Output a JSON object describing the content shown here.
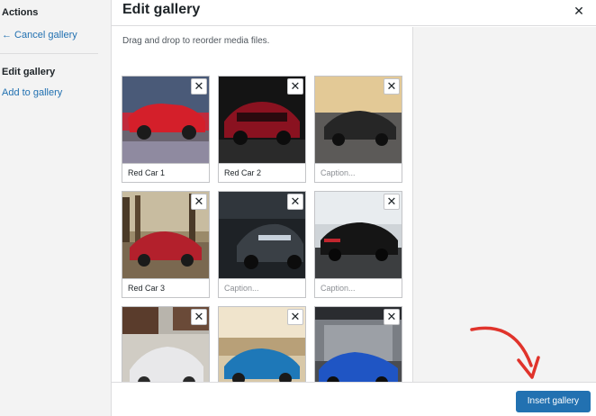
{
  "sidebar": {
    "heading": "Actions",
    "cancel_link": "← Cancel gallery",
    "active_item": "Edit gallery",
    "add_link": "Add to gallery"
  },
  "header": {
    "title": "Edit gallery",
    "close_icon": "close-icon",
    "close_glyph": "✕"
  },
  "instructions": "Drag and drop to reorder media files.",
  "gallery": {
    "remove_glyph": "✕",
    "caption_placeholder": "Caption...",
    "items": [
      {
        "caption": "Red Car 1",
        "placeholder": false
      },
      {
        "caption": "Red Car 2",
        "placeholder": false
      },
      {
        "caption": "Caption...",
        "placeholder": true
      },
      {
        "caption": "Red Car 3",
        "placeholder": false
      },
      {
        "caption": "Caption...",
        "placeholder": true
      },
      {
        "caption": "Caption...",
        "placeholder": true
      },
      {
        "caption": "",
        "placeholder": true
      },
      {
        "caption": "",
        "placeholder": true
      },
      {
        "caption": "",
        "placeholder": true
      }
    ]
  },
  "footer": {
    "insert_button": "Insert gallery"
  },
  "colors": {
    "accent": "#2271b1",
    "annotation_arrow": "#e0332b",
    "sidebar_bg": "#f3f3f3"
  }
}
